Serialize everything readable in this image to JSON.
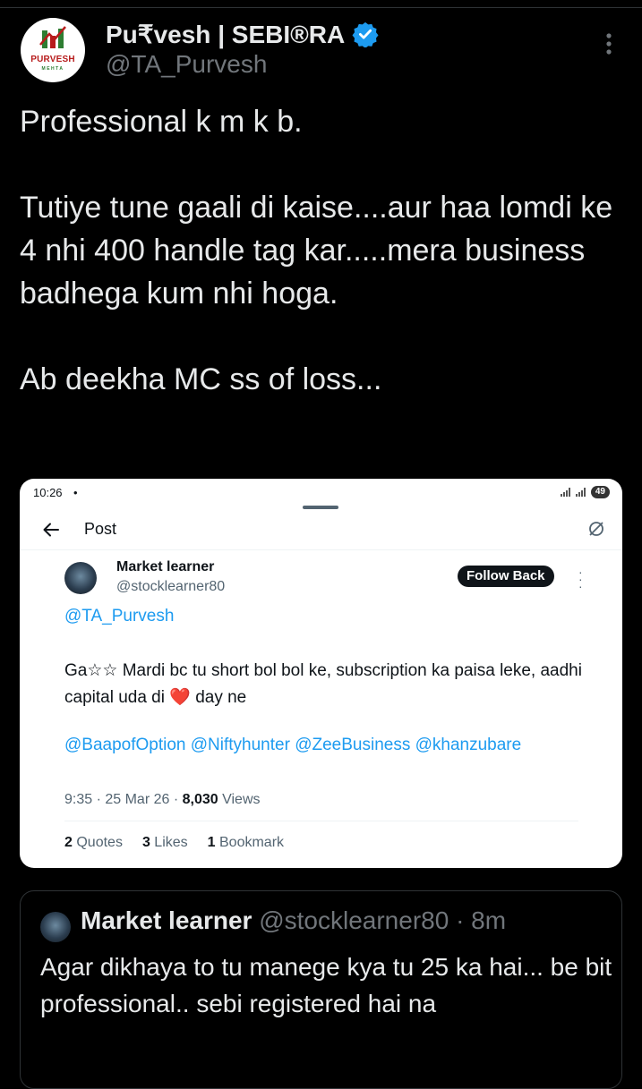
{
  "author": {
    "display_name": "Pu₹vesh | SEBI®RA",
    "handle": "@TA_Purvesh",
    "avatar_text_1": "PURVESH",
    "avatar_text_2": "MEHTA"
  },
  "tweet": {
    "line1": "Professional k m k b.",
    "line2": "Tutiye tune gaali di kaise....aur haa lomdi ke 4 nhi 400 handle tag kar.....mera business badhega kum nhi hoga.",
    "line3": "Ab deekha MC ss of loss..."
  },
  "screenshot": {
    "status_time": "10:26",
    "status_dot": "•",
    "battery": "49",
    "header_title": "Post",
    "author_name": "Market learner",
    "author_handle": "@stocklearner80",
    "follow_label": "Follow Back",
    "reply_to": "@TA_Purvesh",
    "body_part1": "Ga☆☆ Mardi bc tu short bol bol ke, subscription ka paisa leke, aadhi capital  uda di",
    "heart": "❤️",
    "body_part2": " day ne",
    "mentions": "@BaapofOption @Niftyhunter @ZeeBusiness @khanzubare",
    "time": "9:35 · 25 Mar 26 · ",
    "views_count": "8,030",
    "views_label": " Views",
    "quotes_count": "2",
    "quotes_label": " Quotes",
    "likes_count": "3",
    "likes_label": " Likes",
    "bookmarks_count": "1",
    "bookmarks_label": " Bookmark"
  },
  "quoted": {
    "name": "Market learner",
    "meta": " @stocklearner80 · 8m",
    "text": "Agar dikhaya to tu manege kya tu 25 ka hai... be bit professional.. sebi registered hai na"
  },
  "colors": {
    "background": "#000000",
    "text": "#e7e9ea",
    "muted": "#71767b",
    "accent": "#1d9bf0",
    "verified": "#1d9bf0"
  },
  "icons": [
    "verified-badge-icon",
    "more-vertical-icon",
    "back-arrow-icon",
    "refresh-icon",
    "more-icon"
  ]
}
